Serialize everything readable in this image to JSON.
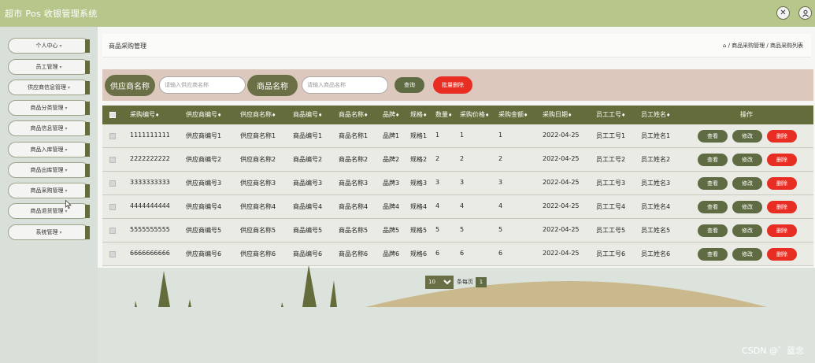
{
  "app": {
    "title": "超市 Pos 收银管理系统"
  },
  "top_icons": [
    "expand-icon",
    "user-icon"
  ],
  "sidebar": {
    "items": [
      {
        "label": "个人中心"
      },
      {
        "label": "员工管理"
      },
      {
        "label": "供应商信息管理"
      },
      {
        "label": "商品分类管理"
      },
      {
        "label": "商品信息管理"
      },
      {
        "label": "商品入库管理"
      },
      {
        "label": "商品出库管理"
      },
      {
        "label": "商品采购管理"
      },
      {
        "label": "商品退货管理"
      },
      {
        "label": "系统管理"
      }
    ]
  },
  "breadcrumb": {
    "title": "商品采购管理",
    "path": "/ 商品采购管理 / 商品采购列表"
  },
  "search": {
    "supplier_label": "供应商名称",
    "supplier_placeholder": "请输入供应商名称",
    "product_label": "商品名称",
    "product_placeholder": "请输入商品名称",
    "search_button": "查询",
    "batch_delete_button": "批量删除"
  },
  "table": {
    "headers": [
      "采购编号",
      "供应商编号",
      "供应商名称",
      "商品编号",
      "商品名称",
      "品牌",
      "规格",
      "数量",
      "采购价格",
      "采购金额",
      "采购日期",
      "员工工号",
      "员工姓名",
      "操作"
    ],
    "sort_mark": "♦",
    "rows": [
      [
        "1111111111",
        "供应商编号1",
        "供应商名称1",
        "商品编号1",
        "商品名称1",
        "品牌1",
        "规格1",
        "1",
        "1",
        "1",
        "2022-04-25",
        "员工工号1",
        "员工姓名1"
      ],
      [
        "2222222222",
        "供应商编号2",
        "供应商名称2",
        "商品编号2",
        "商品名称2",
        "品牌2",
        "规格2",
        "2",
        "2",
        "2",
        "2022-04-25",
        "员工工号2",
        "员工姓名2"
      ],
      [
        "3333333333",
        "供应商编号3",
        "供应商名称3",
        "商品编号3",
        "商品名称3",
        "品牌3",
        "规格3",
        "3",
        "3",
        "3",
        "2022-04-25",
        "员工工号3",
        "员工姓名3"
      ],
      [
        "4444444444",
        "供应商编号4",
        "供应商名称4",
        "商品编号4",
        "商品名称4",
        "品牌4",
        "规格4",
        "4",
        "4",
        "4",
        "2022-04-25",
        "员工工号4",
        "员工姓名4"
      ],
      [
        "5555555555",
        "供应商编号5",
        "供应商名称5",
        "商品编号5",
        "商品名称5",
        "品牌5",
        "规格5",
        "5",
        "5",
        "5",
        "2022-04-25",
        "员工工号5",
        "员工姓名5"
      ],
      [
        "6666666666",
        "供应商编号6",
        "供应商名称6",
        "商品编号6",
        "商品名称6",
        "品牌6",
        "规格6",
        "6",
        "6",
        "6",
        "2022-04-25",
        "员工工号6",
        "员工姓名6"
      ]
    ],
    "actions": {
      "view": "查看",
      "edit": "修改",
      "delete": "删除"
    }
  },
  "pagination": {
    "page_size": "10",
    "per_page_label": "条每页",
    "current_page": "1"
  },
  "watermark": "CSDN @゛蓝念",
  "colors": {
    "olive": "#636c3a",
    "red": "#e82d23",
    "header_bar": "#b7c78b"
  }
}
